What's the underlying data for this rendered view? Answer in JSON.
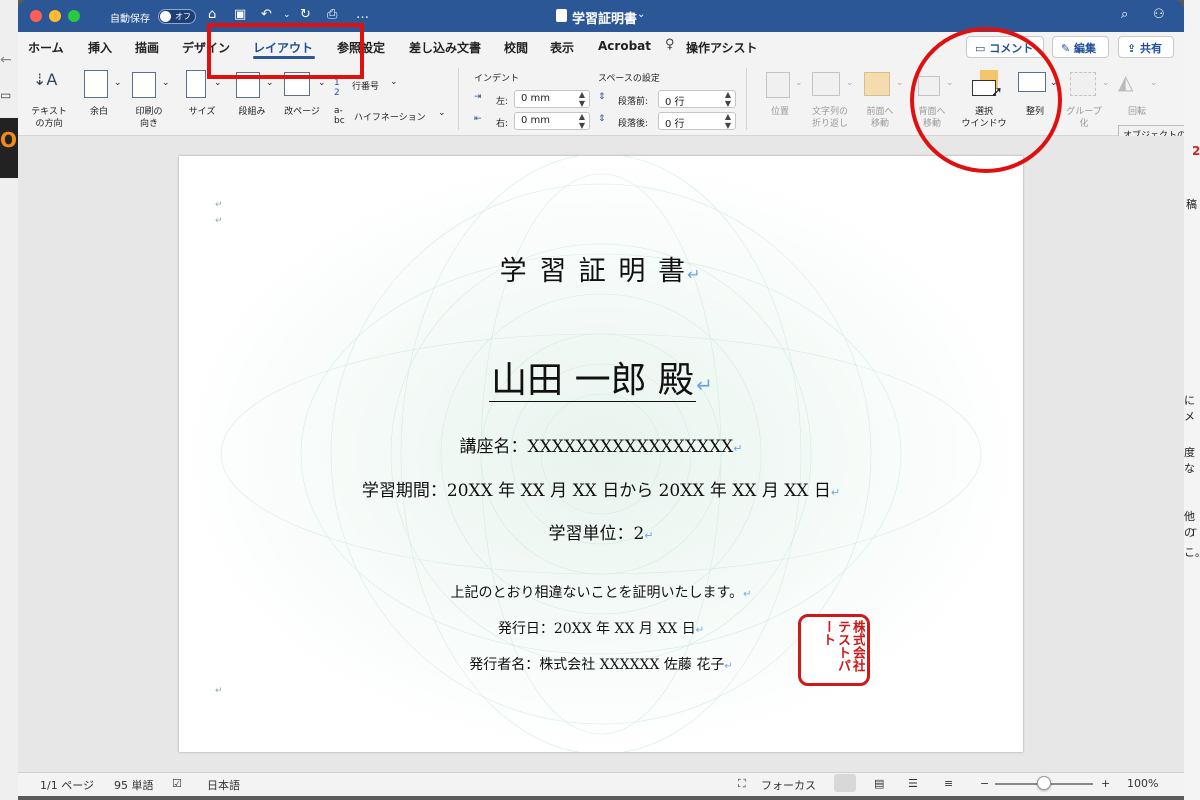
{
  "titlebar": {
    "autosave_label": "自動保存",
    "autosave_state": "オフ",
    "document_title": "学習証明書",
    "more": "…"
  },
  "tabs": [
    {
      "label": "ホーム"
    },
    {
      "label": "挿入"
    },
    {
      "label": "描画"
    },
    {
      "label": "デザイン"
    },
    {
      "label": "レイアウト",
      "active": true
    },
    {
      "label": "参照設定"
    },
    {
      "label": "差し込み文書"
    },
    {
      "label": "校閲"
    },
    {
      "label": "表示"
    },
    {
      "label": "Acrobat"
    },
    {
      "label": "操作アシスト"
    }
  ],
  "header_actions": {
    "comment": "コメント",
    "edit": "編集",
    "share": "共有"
  },
  "ribbon": {
    "text_direction": [
      "テキスト",
      "の方向"
    ],
    "margins": "余白",
    "orientation": [
      "印刷の",
      "向き"
    ],
    "size": "サイズ",
    "columns": "段組み",
    "breaks": "改ページ",
    "line_numbers": "行番号",
    "hyphenation": "ハイフネーション",
    "indent_header": "インデント",
    "indent_left_label": "左:",
    "indent_left_value": "0 mm",
    "indent_right_label": "右:",
    "indent_right_value": "0 mm",
    "spacing_header": "スペースの設定",
    "spacing_before_label": "段落前:",
    "spacing_before_value": "0 行",
    "spacing_after_label": "段落後:",
    "spacing_after_value": "0 行",
    "position": "位置",
    "wrap_text": [
      "文字列の",
      "折り返し"
    ],
    "bring_forward": [
      "前面へ",
      "移動"
    ],
    "send_backward": [
      "背面へ",
      "移動"
    ],
    "selection_pane": [
      "選択",
      "ウインドウ"
    ],
    "align": "整列",
    "group": [
      "グループ",
      "化"
    ],
    "rotate": "回転"
  },
  "tooltip": "オブジェクトの配",
  "document": {
    "title": "学 習 証 明 書",
    "recipient": "山田 一郎 殿",
    "course": "講座名：XXXXXXXXXXXXXXXXX",
    "period": "学習期間：20XX 年 XX 月 XX 日から 20XX 年 XX 月 XX 日",
    "credits": "学習単位：2",
    "certify": "上記のとおり相違ないことを証明いたします。",
    "issue_date": "発行日：20XX 年 XX 月 XX 日",
    "issuer": "発行者名：株式会社 XXXXXX 佐藤 花子",
    "seal_text": "株式会社テストパート",
    "para_mark": "↵"
  },
  "right_strip_fragments": [
    "2",
    "稿",
    "にメ",
    "度な",
    "他の",
    "「",
    "こ。"
  ],
  "left_fragment": "O",
  "statusbar": {
    "page": "1/1 ページ",
    "words": "95 単語",
    "language": "日本語",
    "focus": "フォーカス",
    "zoom": "100%",
    "zoom_fraction": 0.5
  },
  "colors": {
    "titlebar": "#2b5797",
    "accent": "#1f4f99",
    "annotation": "#e01010",
    "seal": "#d01818"
  }
}
